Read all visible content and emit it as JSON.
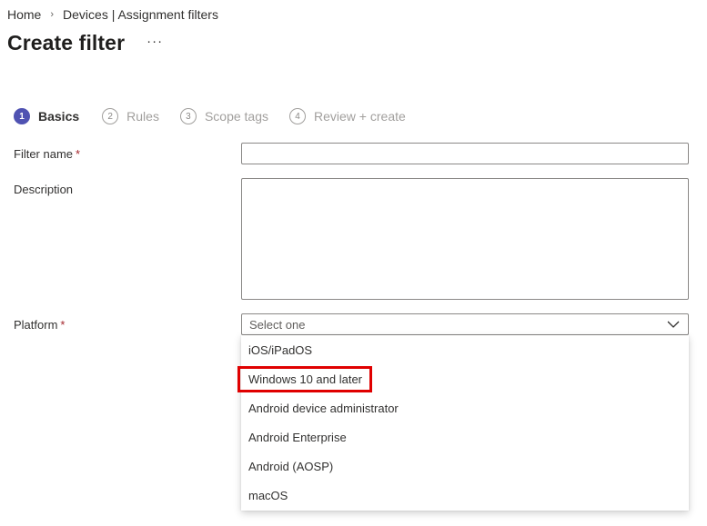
{
  "breadcrumb": {
    "items": [
      "Home",
      "Devices | Assignment filters"
    ],
    "separator": "›"
  },
  "page": {
    "title": "Create filter",
    "more_label": "···"
  },
  "wizard": {
    "steps": [
      {
        "number": "1",
        "label": "Basics",
        "active": true
      },
      {
        "number": "2",
        "label": "Rules",
        "active": false
      },
      {
        "number": "3",
        "label": "Scope tags",
        "active": false
      },
      {
        "number": "4",
        "label": "Review + create",
        "active": false
      }
    ]
  },
  "form": {
    "filter_name": {
      "label": "Filter name",
      "required_mark": "*",
      "value": ""
    },
    "description": {
      "label": "Description",
      "value": ""
    },
    "platform": {
      "label": "Platform",
      "required_mark": "*",
      "placeholder": "Select one",
      "options": [
        "iOS/iPadOS",
        "Windows 10 and later",
        "Android device administrator",
        "Android Enterprise",
        "Android (AOSP)",
        "macOS"
      ],
      "highlighted_option": "Windows 10 and later",
      "highlight_color": "#e00000"
    }
  },
  "colors": {
    "accent": "#4f52b2",
    "required": "#a4262c"
  }
}
